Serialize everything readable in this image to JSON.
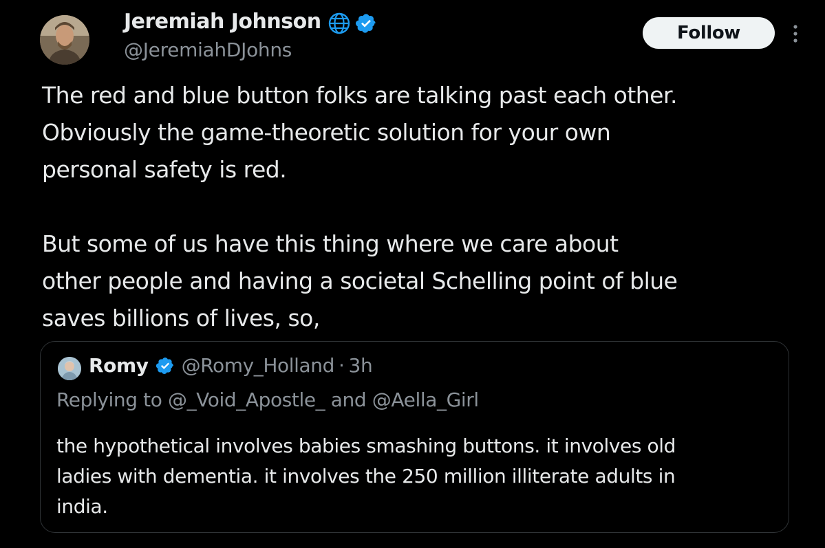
{
  "author": {
    "name": "Jeremiah Johnson",
    "handle": "@JeremiahDJohns",
    "avatar_icon": "profile-photo-icon",
    "badges": [
      "globe-icon",
      "verified-check-icon"
    ]
  },
  "actions": {
    "follow_label": "Follow",
    "more_icon": "more-vertical-icon"
  },
  "tweet": {
    "lines": [
      "The red and blue button folks are talking past each other.",
      "Obviously the game-theoretic solution for your own",
      "personal safety is red.",
      "But some of us have this thing where we care about",
      "other people and having a societal Schelling point of blue",
      "saves billions of lives, so,"
    ]
  },
  "quote": {
    "name": "Romy",
    "handle": "@Romy_Holland",
    "separator": "·",
    "time": "3h",
    "reply_prefix": "Replying to",
    "reply_mention_1": "@_Void_Apostle_",
    "reply_conjunction": "and",
    "reply_mention_2": "@Aella_Girl",
    "body_lines": [
      "the hypothetical involves babies smashing buttons. it involves old",
      "ladies with dementia. it involves the 250 million illiterate adults in",
      "india."
    ]
  },
  "colors": {
    "background": "#000000",
    "text_primary": "#e7e9ea",
    "text_secondary": "#8b9299",
    "verified_blue": "#1d9bf0",
    "border": "#2f3336",
    "follow_bg": "#eff3f4"
  }
}
